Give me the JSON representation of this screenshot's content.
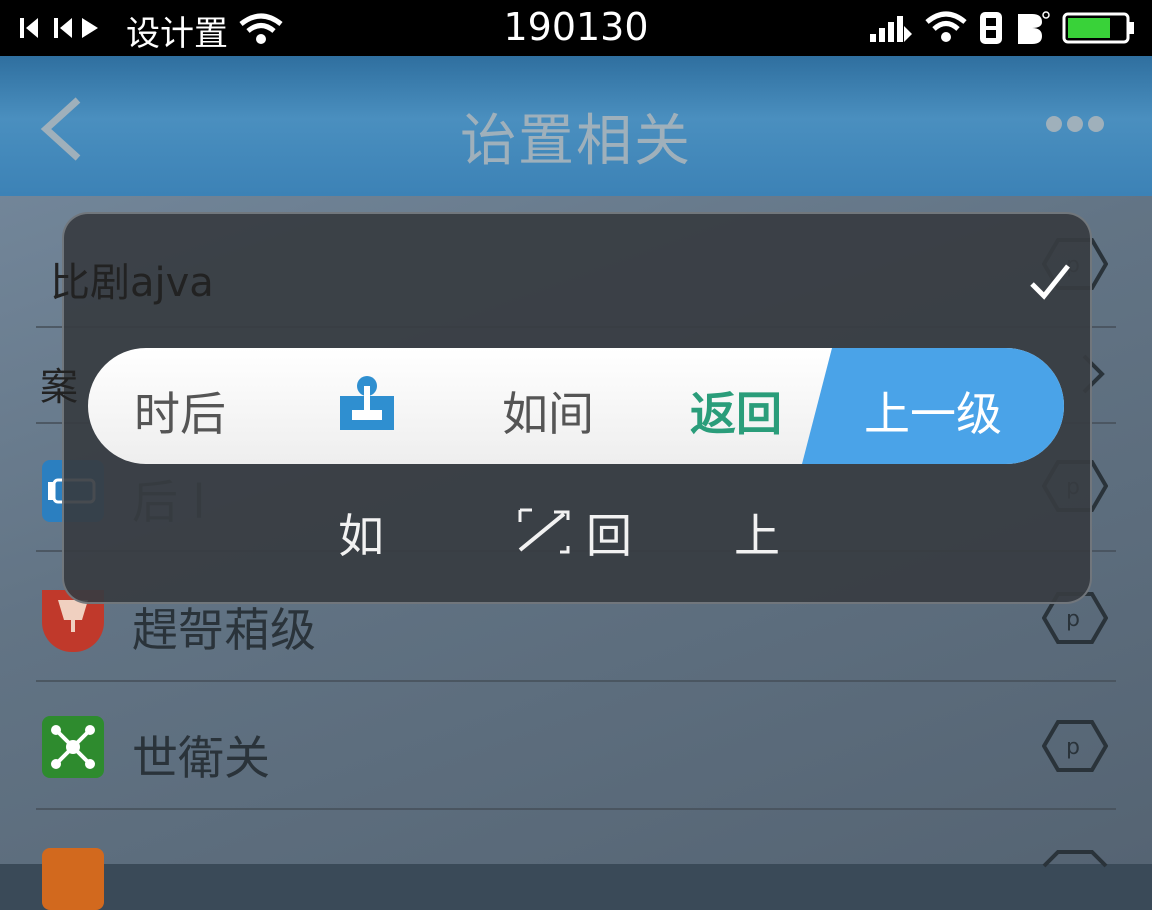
{
  "status_bar": {
    "carrier": "设计置",
    "time": "190130"
  },
  "header": {
    "title": "诒置相关"
  },
  "list": [
    {
      "label": "",
      "icon": "none"
    },
    {
      "label": "",
      "icon": "none"
    },
    {
      "label": "后 l",
      "icon": "message-card-icon",
      "color": "#2b7fc0"
    },
    {
      "label": "趕哿葙级",
      "icon": "cup-icon",
      "color": "#c0392b"
    },
    {
      "label": "世衛关",
      "icon": "network-icon",
      "color": "#2e8b2e"
    },
    {
      "label": "",
      "icon": "orange-icon",
      "color": "#d2691e"
    }
  ],
  "overlay": {
    "title": "比剧ajva",
    "partial_row_label": "案",
    "segments": [
      {
        "label": "时后",
        "color": "#555555"
      },
      {
        "label": "",
        "icon": "pin-download-icon",
        "color": "#2f8fd0"
      },
      {
        "label": "如间",
        "color": "#555555"
      },
      {
        "label": "返回",
        "color": "#2a9d7a"
      },
      {
        "label": "上一级",
        "color": "#ffffff"
      }
    ],
    "sub_items": [
      {
        "label": "如"
      },
      {
        "label": "回",
        "icon": "resize-icon"
      },
      {
        "label": "上"
      }
    ]
  },
  "colors": {
    "accent": "#4aa3e8",
    "status_bar_bg": "#000000",
    "header_bg": "#3c82b6",
    "return_green": "#2a9d7a"
  }
}
